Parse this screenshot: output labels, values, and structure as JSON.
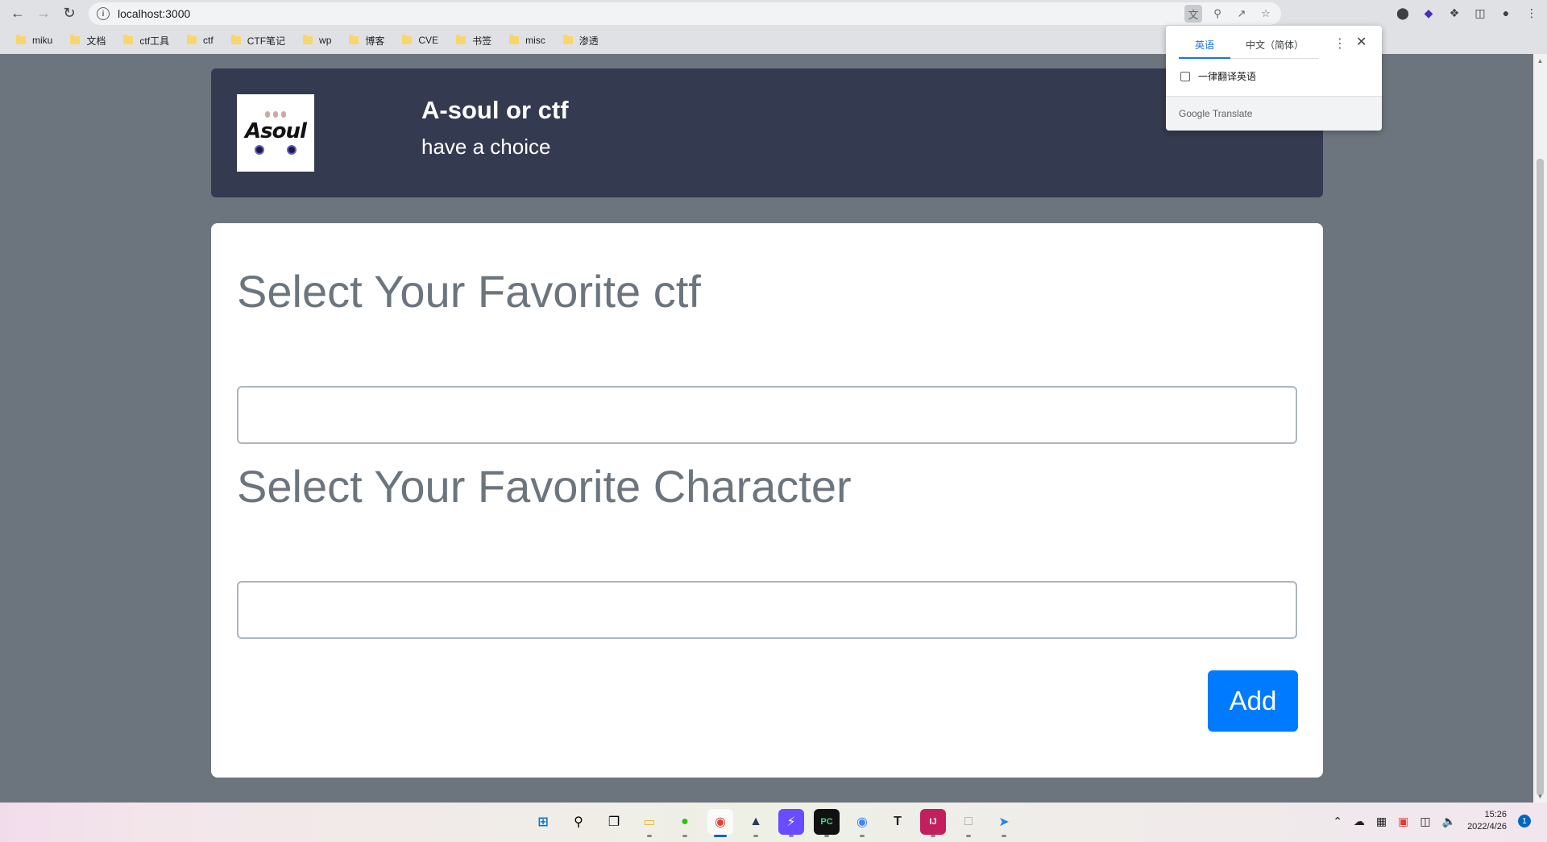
{
  "browser": {
    "url": "localhost:3000",
    "bookmarks": [
      "miku",
      "文档",
      "ctf工具",
      "ctf",
      "CTF笔记",
      "wp",
      "博客",
      "CVE",
      "书签",
      "misc",
      "渗透"
    ]
  },
  "header": {
    "logo_text": "Asoul",
    "title": "A-soul or ctf",
    "subtitle": "have a choice"
  },
  "form": {
    "heading_ctf": "Select Your Favorite ctf",
    "ctf_value": "",
    "heading_character": "Select Your Favorite Character",
    "character_value": "",
    "add_label": "Add",
    "accent": "#007bff"
  },
  "translate_popup": {
    "tab_source": "英语",
    "tab_target": "中文（简体）",
    "always_translate": "一律翻译英语",
    "footer": "Google Translate"
  },
  "taskbar": {
    "time": "15:26",
    "date": "2022/4/26",
    "notification_count": "1"
  },
  "colors": {
    "page_bg": "#6c757d",
    "header_bg": "#343a4f",
    "taskbar_active": "#0067c0"
  }
}
